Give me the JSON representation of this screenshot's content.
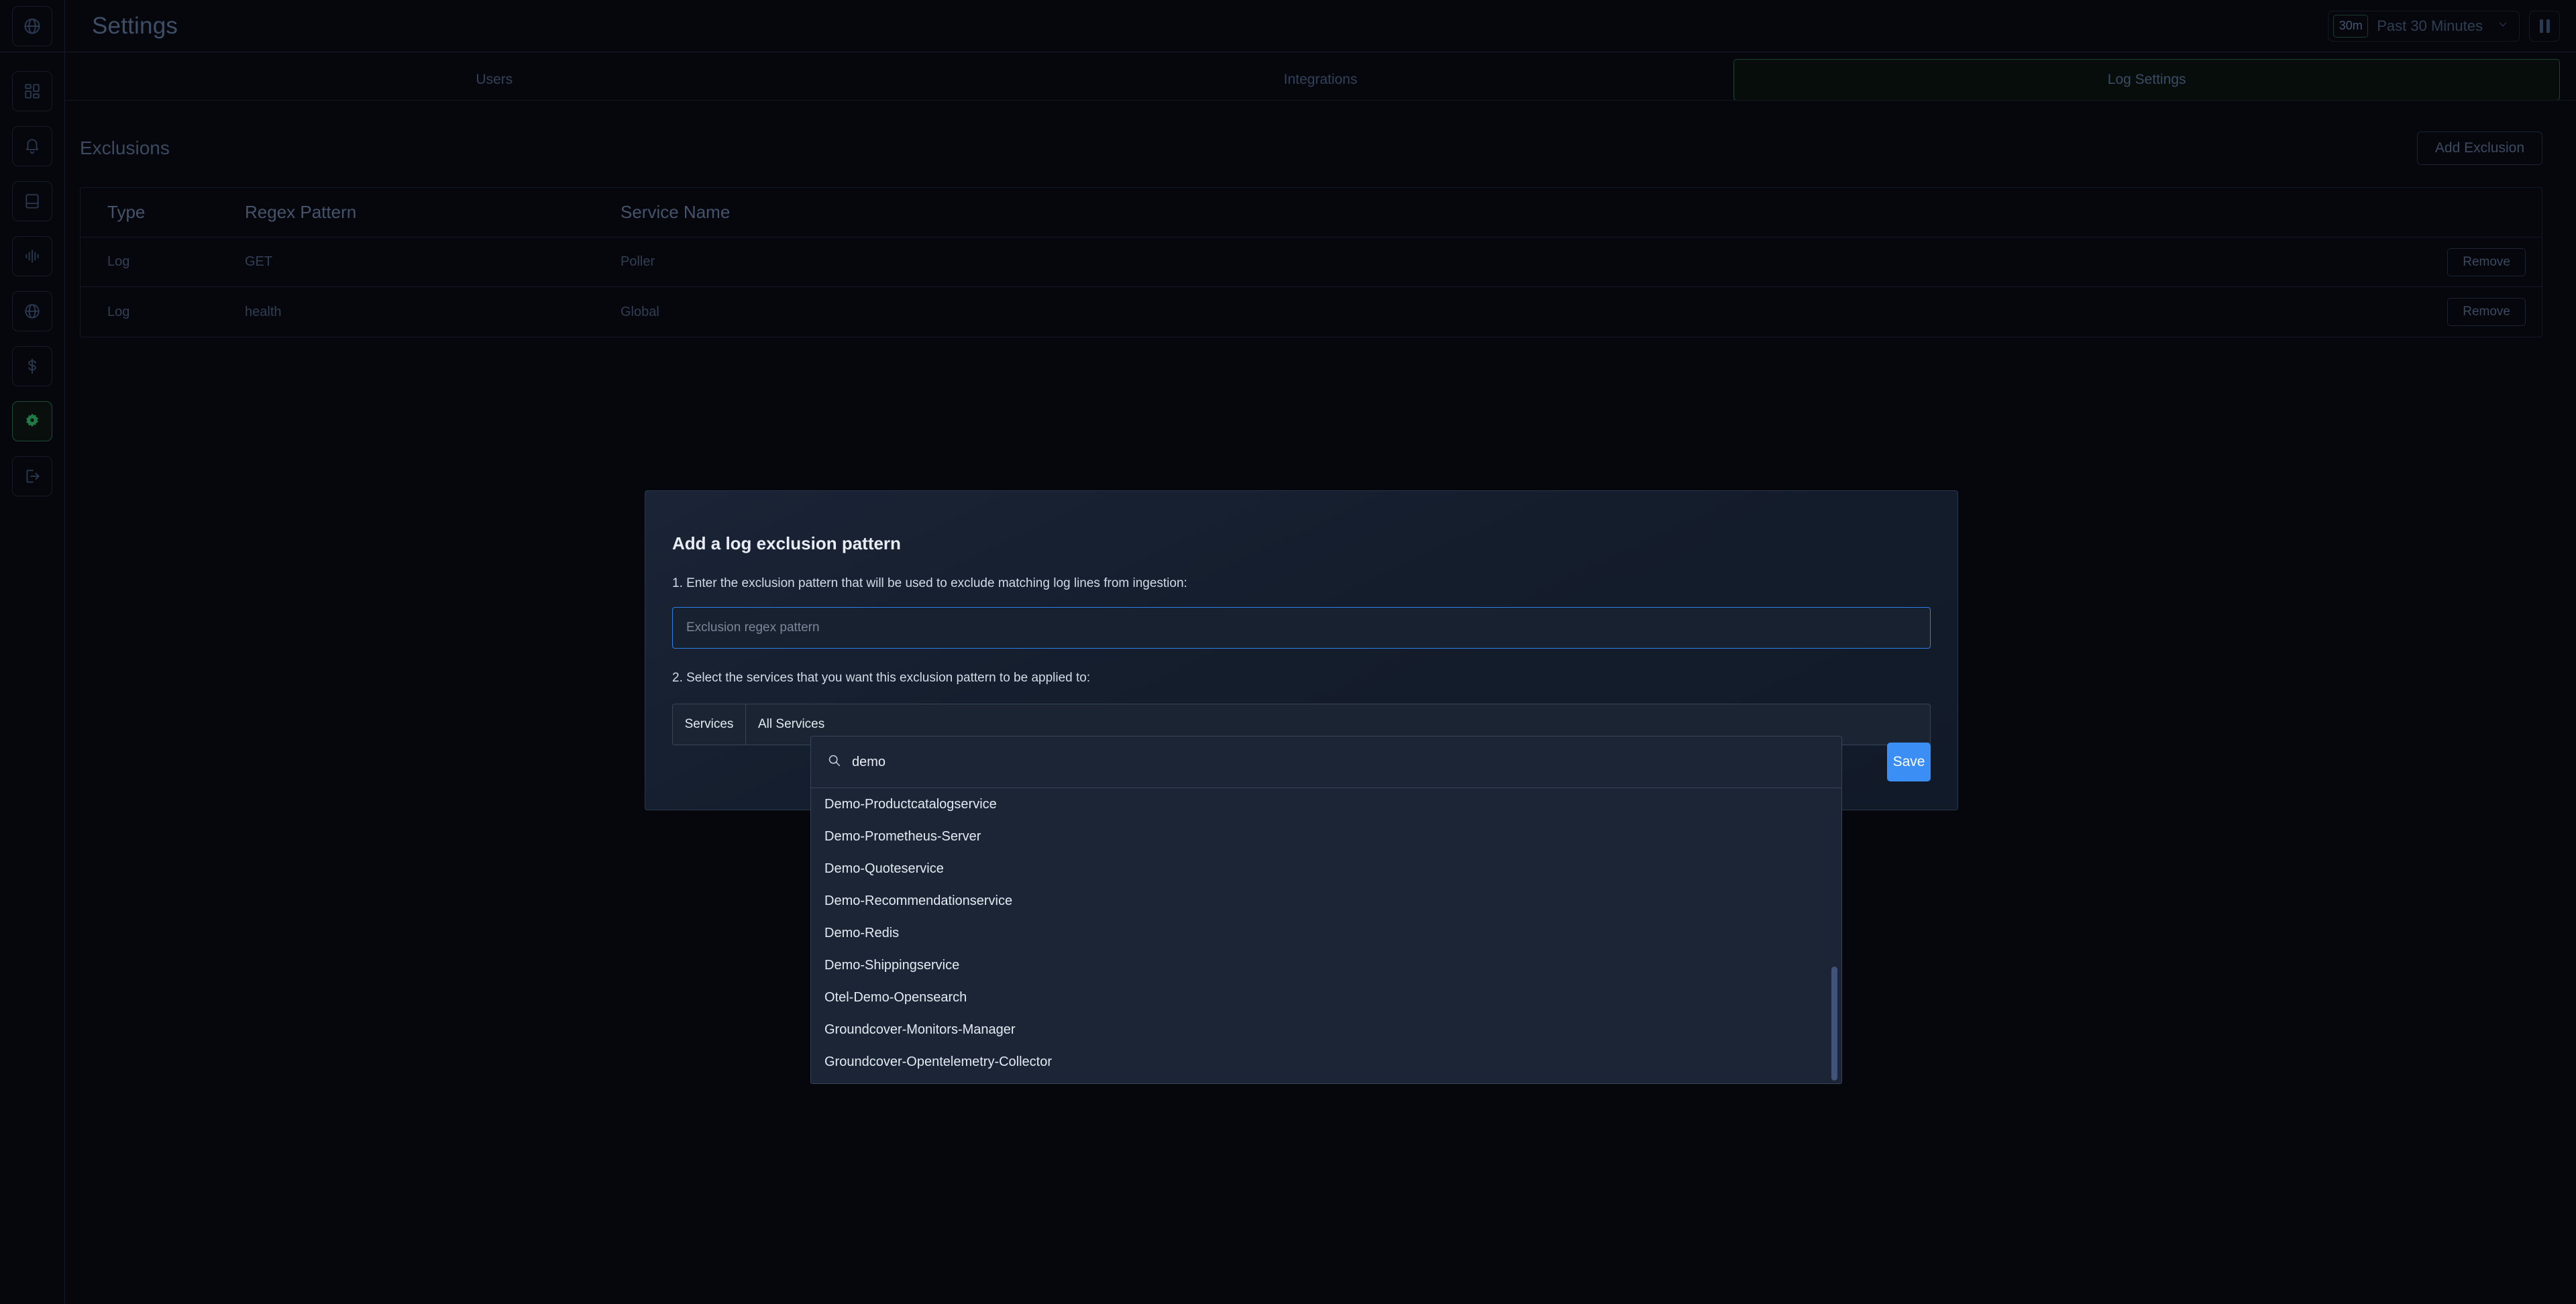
{
  "colors": {
    "app_bg": "#05070c",
    "accent_green": "#1f7a45",
    "accent_blue": "#3b8ef3",
    "modal_bg": "#16202f",
    "dropdown_bg": "#1b2535"
  },
  "sidebar": {
    "logo_icon": "globe-icon",
    "items": [
      {
        "icon": "dashboard-grid-icon",
        "name": "sidebar-item-dashboard",
        "active": false
      },
      {
        "icon": "bell-icon",
        "name": "sidebar-item-alerts",
        "active": false
      },
      {
        "icon": "book-icon",
        "name": "sidebar-item-logs",
        "active": false
      },
      {
        "icon": "waveform-icon",
        "name": "sidebar-item-traces",
        "active": false
      },
      {
        "icon": "globe-icon",
        "name": "sidebar-item-network",
        "active": false
      },
      {
        "icon": "dollar-icon",
        "name": "sidebar-item-cost",
        "active": false
      },
      {
        "icon": "gear-icon",
        "name": "sidebar-item-settings",
        "active": true
      },
      {
        "icon": "logout-icon",
        "name": "sidebar-item-logout",
        "active": false
      }
    ]
  },
  "topbar": {
    "title": "Settings",
    "time_range": {
      "badge": "30m",
      "label": "Past 30 Minutes",
      "chevron_icon": "chevron-down-icon"
    },
    "pause_icon": "pause-icon"
  },
  "tabs": [
    {
      "label": "Users",
      "active": false
    },
    {
      "label": "Integrations",
      "active": false
    },
    {
      "label": "Log Settings",
      "active": true
    }
  ],
  "exclusions": {
    "title": "Exclusions",
    "add_button": "Add Exclusion",
    "columns": [
      "Type",
      "Regex Pattern",
      "Service Name",
      ""
    ],
    "rows": [
      {
        "type": "Log",
        "regex": "GET",
        "service": "Poller",
        "action": "Remove"
      },
      {
        "type": "Log",
        "regex": "health",
        "service": "Global",
        "action": "Remove"
      }
    ]
  },
  "modal": {
    "title": "Add a log exclusion pattern",
    "step1": "1. Enter the exclusion pattern that will be used to exclude matching log lines from ingestion:",
    "regex_placeholder": "Exclusion regex pattern",
    "regex_value": "",
    "step2": "2. Select the services that you want this exclusion pattern to be applied to:",
    "services_chip": "Services",
    "services_value": "All Services",
    "save_label": "Save"
  },
  "dropdown": {
    "search_icon": "search-icon",
    "search_value": "demo",
    "items": [
      "Demo-Productcatalogservice",
      "Demo-Prometheus-Server",
      "Demo-Quoteservice",
      "Demo-Recommendationservice",
      "Demo-Redis",
      "Demo-Shippingservice",
      "Otel-Demo-Opensearch",
      "Groundcover-Monitors-Manager",
      "Groundcover-Opentelemetry-Collector"
    ]
  }
}
